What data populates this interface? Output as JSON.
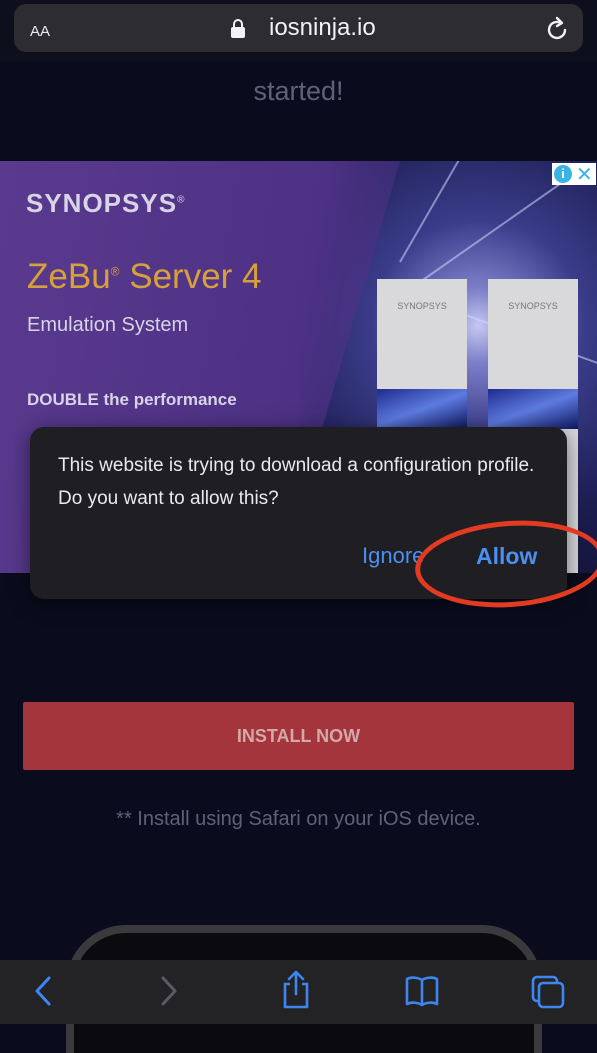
{
  "address_bar": {
    "text_size_label": "AA",
    "url": "iosninja.io"
  },
  "page": {
    "heading_fragment": "started!",
    "install_button_label": "INSTALL NOW",
    "install_note": "** Install using Safari on your iOS device."
  },
  "ad": {
    "brand": "SYNOPSYS",
    "product_name": "ZeBu",
    "product_version": "Server 4",
    "product_subtitle": "Emulation System",
    "tagline": "DOUBLE the performance",
    "box_label": "SYNOPSYS"
  },
  "dialog": {
    "message": "This website is trying to download a configuration profile. Do you want to allow this?",
    "ignore_label": "Ignore",
    "allow_label": "Allow"
  },
  "colors": {
    "accent_blue": "#4b8ff0",
    "install_red": "#a4353c",
    "annotation_red": "#e23b22"
  }
}
